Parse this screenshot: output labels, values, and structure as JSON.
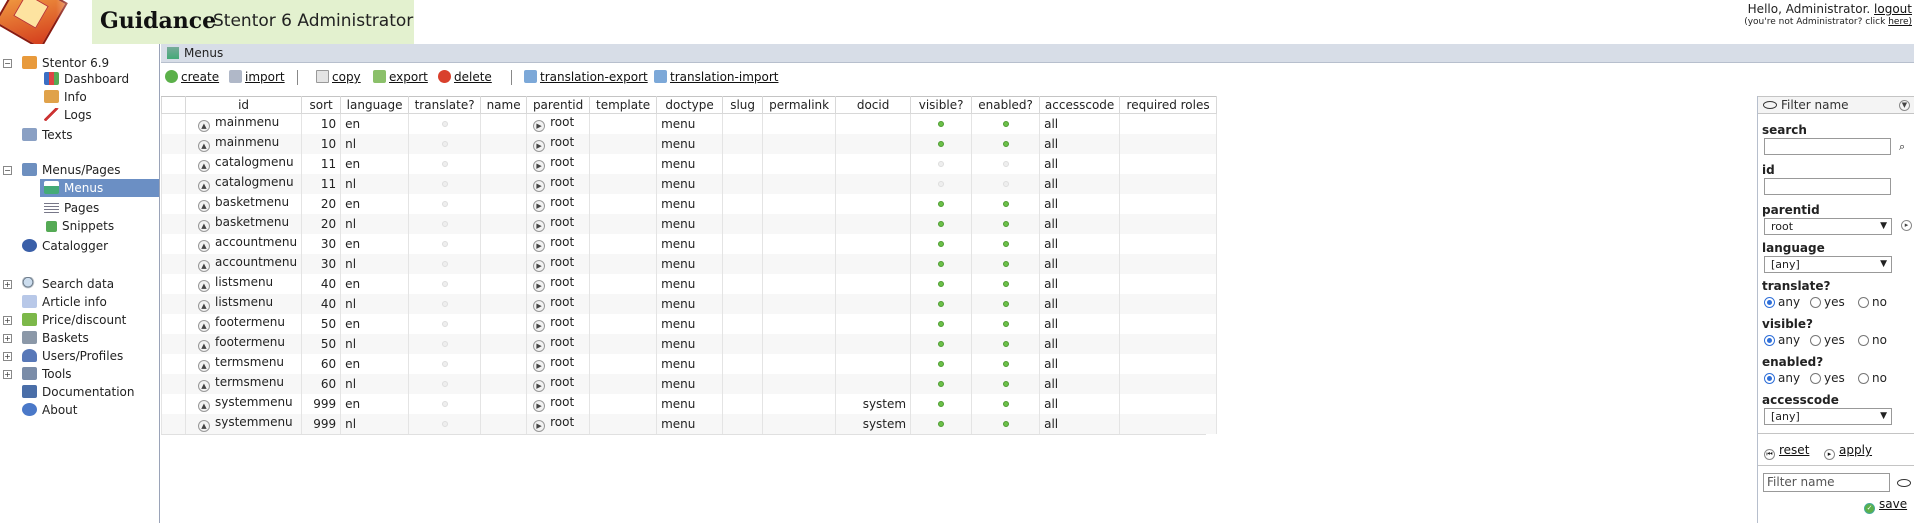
{
  "header": {
    "app_name": "Guidance",
    "app_subtitle": "Stentor 6 Administrator",
    "greeting": "Hello, Administrator.",
    "logout_label": "logout",
    "note": "(you're not Administrator? click",
    "note_link": "here)"
  },
  "sidebar": {
    "items": [
      {
        "label": "Stentor 6.9",
        "icon": "home-icon"
      },
      {
        "label": "Dashboard",
        "icon": "dashboard-icon"
      },
      {
        "label": "Info",
        "icon": "info-home-icon"
      },
      {
        "label": "Logs",
        "icon": "logs-icon"
      },
      {
        "label": "Texts",
        "icon": "texts-icon"
      },
      {
        "label": "Menus/Pages",
        "icon": "menus-pages-icon"
      },
      {
        "label": "Menus",
        "icon": "menus-icon"
      },
      {
        "label": "Pages",
        "icon": "pages-icon"
      },
      {
        "label": "Snippets",
        "icon": "snippets-icon"
      },
      {
        "label": "Catalogger",
        "icon": "catalogger-icon"
      },
      {
        "label": "Search data",
        "icon": "search-data-icon"
      },
      {
        "label": "Article info",
        "icon": "article-info-icon"
      },
      {
        "label": "Price/discount",
        "icon": "price-discount-icon"
      },
      {
        "label": "Baskets",
        "icon": "baskets-icon"
      },
      {
        "label": "Users/Profiles",
        "icon": "users-profiles-icon"
      },
      {
        "label": "Tools",
        "icon": "tools-icon"
      },
      {
        "label": "Documentation",
        "icon": "documentation-icon"
      },
      {
        "label": "About",
        "icon": "about-icon"
      }
    ]
  },
  "content": {
    "title": "Menus"
  },
  "toolbar": {
    "create": "create",
    "import": "import",
    "copy": "copy",
    "export": "export",
    "delete": "delete",
    "translation_export": "translation-export",
    "translation_import": "translation-import"
  },
  "table": {
    "columns": [
      "id",
      "sort",
      "language",
      "translate?",
      "name",
      "parentid",
      "template",
      "doctype",
      "slug",
      "permalink",
      "docid",
      "visible?",
      "enabled?",
      "accesscode",
      "required roles"
    ],
    "rows": [
      {
        "id": "mainmenu",
        "sort": "10",
        "language": "en",
        "translate": false,
        "parentid": "root",
        "doctype": "menu",
        "docid": "",
        "visible": true,
        "enabled": true,
        "accesscode": "all"
      },
      {
        "id": "mainmenu",
        "sort": "10",
        "language": "nl",
        "translate": false,
        "parentid": "root",
        "doctype": "menu",
        "docid": "",
        "visible": true,
        "enabled": true,
        "accesscode": "all"
      },
      {
        "id": "catalogmenu",
        "sort": "11",
        "language": "en",
        "translate": false,
        "parentid": "root",
        "doctype": "menu",
        "docid": "",
        "visible": false,
        "enabled": false,
        "accesscode": "all"
      },
      {
        "id": "catalogmenu",
        "sort": "11",
        "language": "nl",
        "translate": false,
        "parentid": "root",
        "doctype": "menu",
        "docid": "",
        "visible": false,
        "enabled": false,
        "accesscode": "all"
      },
      {
        "id": "basketmenu",
        "sort": "20",
        "language": "en",
        "translate": false,
        "parentid": "root",
        "doctype": "menu",
        "docid": "",
        "visible": true,
        "enabled": true,
        "accesscode": "all"
      },
      {
        "id": "basketmenu",
        "sort": "20",
        "language": "nl",
        "translate": false,
        "parentid": "root",
        "doctype": "menu",
        "docid": "",
        "visible": true,
        "enabled": true,
        "accesscode": "all"
      },
      {
        "id": "accountmenu",
        "sort": "30",
        "language": "en",
        "translate": false,
        "parentid": "root",
        "doctype": "menu",
        "docid": "",
        "visible": true,
        "enabled": true,
        "accesscode": "all"
      },
      {
        "id": "accountmenu",
        "sort": "30",
        "language": "nl",
        "translate": false,
        "parentid": "root",
        "doctype": "menu",
        "docid": "",
        "visible": true,
        "enabled": true,
        "accesscode": "all"
      },
      {
        "id": "listsmenu",
        "sort": "40",
        "language": "en",
        "translate": false,
        "parentid": "root",
        "doctype": "menu",
        "docid": "",
        "visible": true,
        "enabled": true,
        "accesscode": "all"
      },
      {
        "id": "listsmenu",
        "sort": "40",
        "language": "nl",
        "translate": false,
        "parentid": "root",
        "doctype": "menu",
        "docid": "",
        "visible": true,
        "enabled": true,
        "accesscode": "all"
      },
      {
        "id": "footermenu",
        "sort": "50",
        "language": "en",
        "translate": false,
        "parentid": "root",
        "doctype": "menu",
        "docid": "",
        "visible": true,
        "enabled": true,
        "accesscode": "all"
      },
      {
        "id": "footermenu",
        "sort": "50",
        "language": "nl",
        "translate": false,
        "parentid": "root",
        "doctype": "menu",
        "docid": "",
        "visible": true,
        "enabled": true,
        "accesscode": "all"
      },
      {
        "id": "termsmenu",
        "sort": "60",
        "language": "en",
        "translate": false,
        "parentid": "root",
        "doctype": "menu",
        "docid": "",
        "visible": true,
        "enabled": true,
        "accesscode": "all"
      },
      {
        "id": "termsmenu",
        "sort": "60",
        "language": "nl",
        "translate": false,
        "parentid": "root",
        "doctype": "menu",
        "docid": "",
        "visible": true,
        "enabled": true,
        "accesscode": "all"
      },
      {
        "id": "systemmenu",
        "sort": "999",
        "language": "en",
        "translate": false,
        "parentid": "root",
        "doctype": "menu",
        "docid": "system",
        "visible": true,
        "enabled": true,
        "accesscode": "all"
      },
      {
        "id": "systemmenu",
        "sort": "999",
        "language": "nl",
        "translate": false,
        "parentid": "root",
        "doctype": "menu",
        "docid": "system",
        "visible": true,
        "enabled": true,
        "accesscode": "all"
      }
    ]
  },
  "filter": {
    "title": "Filter name",
    "search_label": "search",
    "id_label": "id",
    "parentid_label": "parentid",
    "parentid_value": "root",
    "language_label": "language",
    "language_value": "[any]",
    "translate_label": "translate?",
    "visible_label": "visible?",
    "enabled_label": "enabled?",
    "opt_any": "any",
    "opt_yes": "yes",
    "opt_no": "no",
    "accesscode_label": "accesscode",
    "accesscode_value": "[any]",
    "reset_label": "reset",
    "apply_label": "apply",
    "filter_name_placeholder": "Filter name",
    "save_label": "save"
  },
  "colors": {
    "header_bg": "#e3f1cf",
    "sidebar_selected": "#6b8fc4",
    "status_on": "#6cc04a",
    "radio_selected": "#2f6fd8"
  }
}
